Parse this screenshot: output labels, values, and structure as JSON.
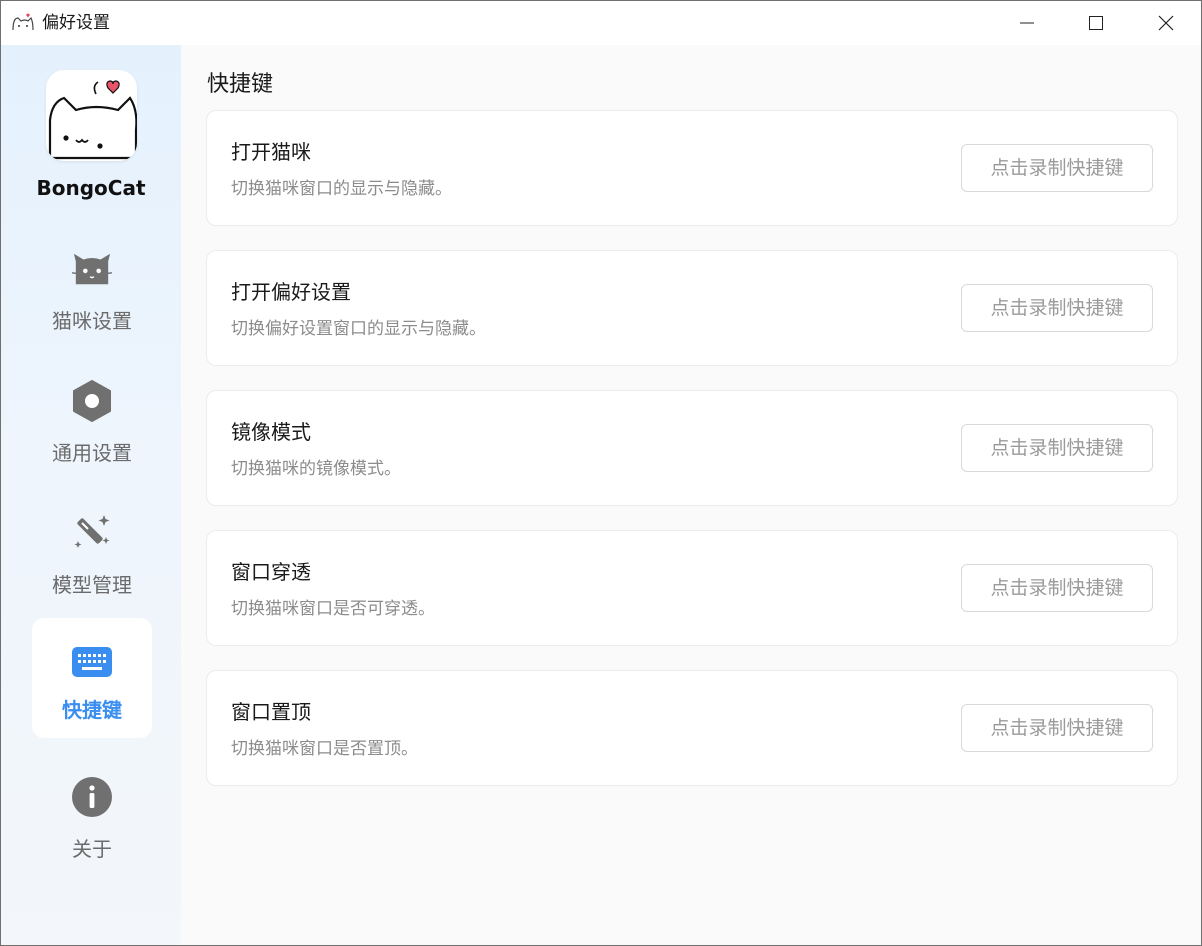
{
  "window": {
    "title": "偏好设置"
  },
  "sidebar": {
    "brand": "BongoCat",
    "items": [
      {
        "label": "猫咪设置",
        "icon": "cat-icon",
        "active": false
      },
      {
        "label": "通用设置",
        "icon": "settings-hex-icon",
        "active": false
      },
      {
        "label": "模型管理",
        "icon": "magic-wand-icon",
        "active": false
      },
      {
        "label": "快捷键",
        "icon": "keyboard-icon",
        "active": true
      },
      {
        "label": "关于",
        "icon": "info-icon",
        "active": false
      }
    ]
  },
  "main": {
    "title": "快捷键",
    "shortcuts": [
      {
        "title": "打开猫咪",
        "desc": "切换猫咪窗口的显示与隐藏。",
        "button": "点击录制快捷键"
      },
      {
        "title": "打开偏好设置",
        "desc": "切换偏好设置窗口的显示与隐藏。",
        "button": "点击录制快捷键"
      },
      {
        "title": "镜像模式",
        "desc": "切换猫咪的镜像模式。",
        "button": "点击录制快捷键"
      },
      {
        "title": "窗口穿透",
        "desc": "切换猫咪窗口是否可穿透。",
        "button": "点击录制快捷键"
      },
      {
        "title": "窗口置顶",
        "desc": "切换猫咪窗口是否置顶。",
        "button": "点击录制快捷键"
      }
    ]
  },
  "colors": {
    "accent": "#3a8ef0",
    "icon_gray": "#6e6e6e"
  }
}
